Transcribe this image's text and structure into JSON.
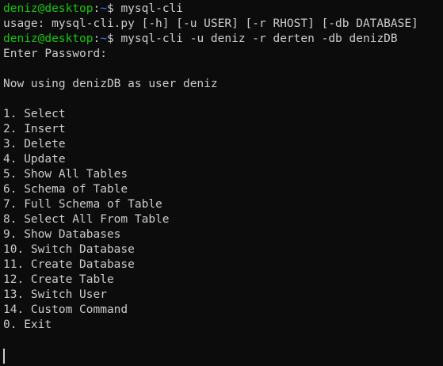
{
  "terminal": {
    "colors": {
      "background": "#0c0c0c",
      "foreground": "#cccccc",
      "prompt_user": "#16c60c",
      "prompt_path": "#3b78ff"
    },
    "prompt1": {
      "user_host": "deniz@desktop",
      "colon": ":",
      "path": "~",
      "symbol": "$ ",
      "command": "mysql-cli"
    },
    "usage_line": "usage: mysql-cli.py [-h] [-u USER] [-r RHOST] [-db DATABASE]",
    "prompt2": {
      "user_host": "deniz@desktop",
      "colon": ":",
      "path": "~",
      "symbol": "$ ",
      "command": "mysql-cli -u deniz -r derten -db denizDB"
    },
    "password_prompt": "Enter Password:",
    "status_line": "Now using denizDB as user deniz",
    "menu": [
      "1. Select",
      "2. Insert",
      "3. Delete",
      "4. Update",
      "5. Show All Tables",
      "6. Schema of Table",
      "7. Full Schema of Table",
      "8. Select All From Table",
      "9. Show Databases",
      "10. Switch Database",
      "11. Create Database",
      "12. Create Table",
      "13. Switch User",
      "14. Custom Command",
      "0. Exit"
    ]
  }
}
